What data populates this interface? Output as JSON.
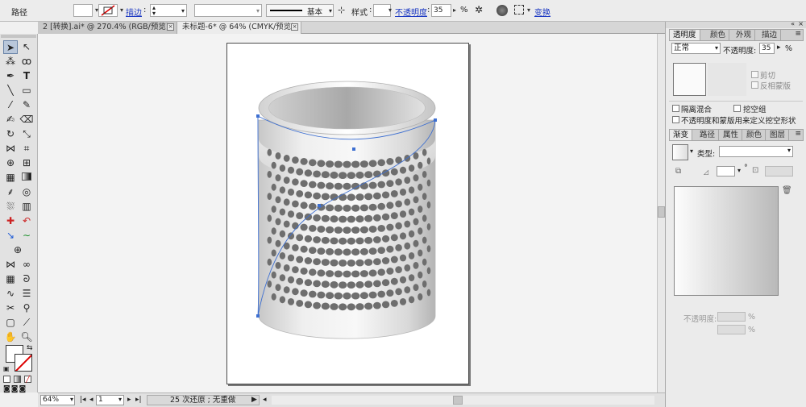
{
  "control_bar": {
    "object_type": "路径",
    "stroke_label": "描边",
    "stroke_sep": ":",
    "stroke_profile": "基本",
    "style_label": "样式",
    "style_sep": ":",
    "opacity_label": "不透明度",
    "opacity_sep": ":",
    "opacity_value": "35",
    "opacity_unit": "%",
    "transform_link": "变换"
  },
  "document_tabs": [
    {
      "label": "2 [转换].ai* @ 270.4% (RGB/预览)",
      "active": false
    },
    {
      "label": "未标题-6* @ 64% (CMYK/预览)",
      "active": true
    }
  ],
  "status_bar": {
    "zoom": "64%",
    "page": "1",
    "history": "25 次还原 ; 无重做"
  },
  "transparency_panel": {
    "tabs": [
      "透明度",
      "颜色",
      "外观",
      "描边"
    ],
    "blend_mode": "正常",
    "opacity_label": "不透明度:",
    "opacity_value": "35",
    "opacity_unit": "%",
    "clip": "剪切",
    "invert_mask": "反相蒙版",
    "isolate_blend": "隔离混合",
    "knockout_group": "挖空组",
    "opacity_mask_knockout": "不透明度和蒙版用来定义挖空形状"
  },
  "gradient_panel": {
    "tabs": [
      "渐变",
      "路径",
      "属性",
      "颜色",
      "图层"
    ],
    "type_label": "类型:",
    "opacity_label": "不透明度:",
    "opacity_unit": "%",
    "degree": "°"
  },
  "colors": {
    "accent_link": "#1a37c2",
    "selection_path": "#3d6fd1",
    "hole_color": "#6e6e6e"
  }
}
